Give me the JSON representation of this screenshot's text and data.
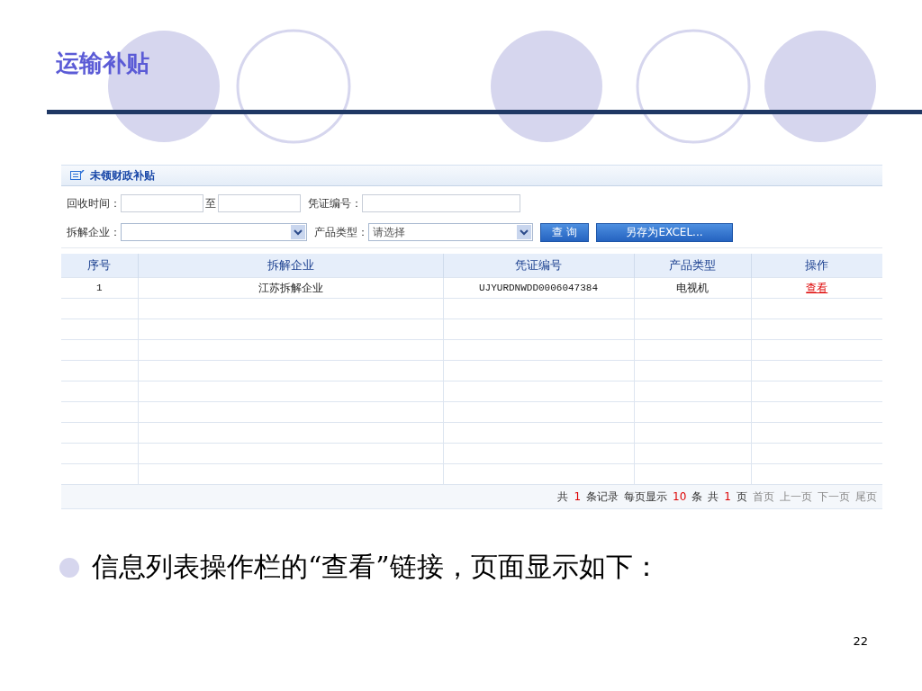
{
  "slide": {
    "title": "运输补贴",
    "bullet": "信息列表操作栏的“查看”链接，页面显示如下：",
    "page_number": "22"
  },
  "panel": {
    "title": "未领财政补贴",
    "filters": [
      {
        "kind": "date-range",
        "label": "回收时间：",
        "separator": "至"
      },
      {
        "kind": "text",
        "label": "凭证编号："
      },
      {
        "kind": "select",
        "label": "拆解企业："
      },
      {
        "kind": "select",
        "label": "产品类型：",
        "placeholder": "请选择"
      }
    ],
    "buttons": [
      {
        "kind": "query",
        "label": "查 询"
      },
      {
        "kind": "export",
        "label": "另存为EXCEL..."
      }
    ],
    "table": {
      "columns": [
        "序号",
        "拆解企业",
        "凭证编号",
        "产品类型",
        "操作"
      ],
      "rows": [
        {
          "cells": [
            "1",
            "江苏拆解企业",
            "UJYURDNWDD0006047384",
            "电视机"
          ],
          "action": "查看"
        }
      ]
    },
    "pager": [
      {
        "kind": "text",
        "text": "共"
      },
      {
        "kind": "number",
        "text": "1"
      },
      {
        "kind": "text",
        "text": "条记录"
      },
      {
        "kind": "text",
        "text": "每页显示"
      },
      {
        "kind": "number",
        "text": "10"
      },
      {
        "kind": "text",
        "text": "条"
      },
      {
        "kind": "text",
        "text": "共"
      },
      {
        "kind": "number",
        "text": "1"
      },
      {
        "kind": "text",
        "text": "页"
      },
      {
        "kind": "nav",
        "text": "首页",
        "disabled": true
      },
      {
        "kind": "nav",
        "text": "上一页",
        "disabled": true
      },
      {
        "kind": "nav",
        "text": "下一页",
        "disabled": true
      },
      {
        "kind": "nav",
        "text": "尾页",
        "disabled": true
      }
    ]
  }
}
